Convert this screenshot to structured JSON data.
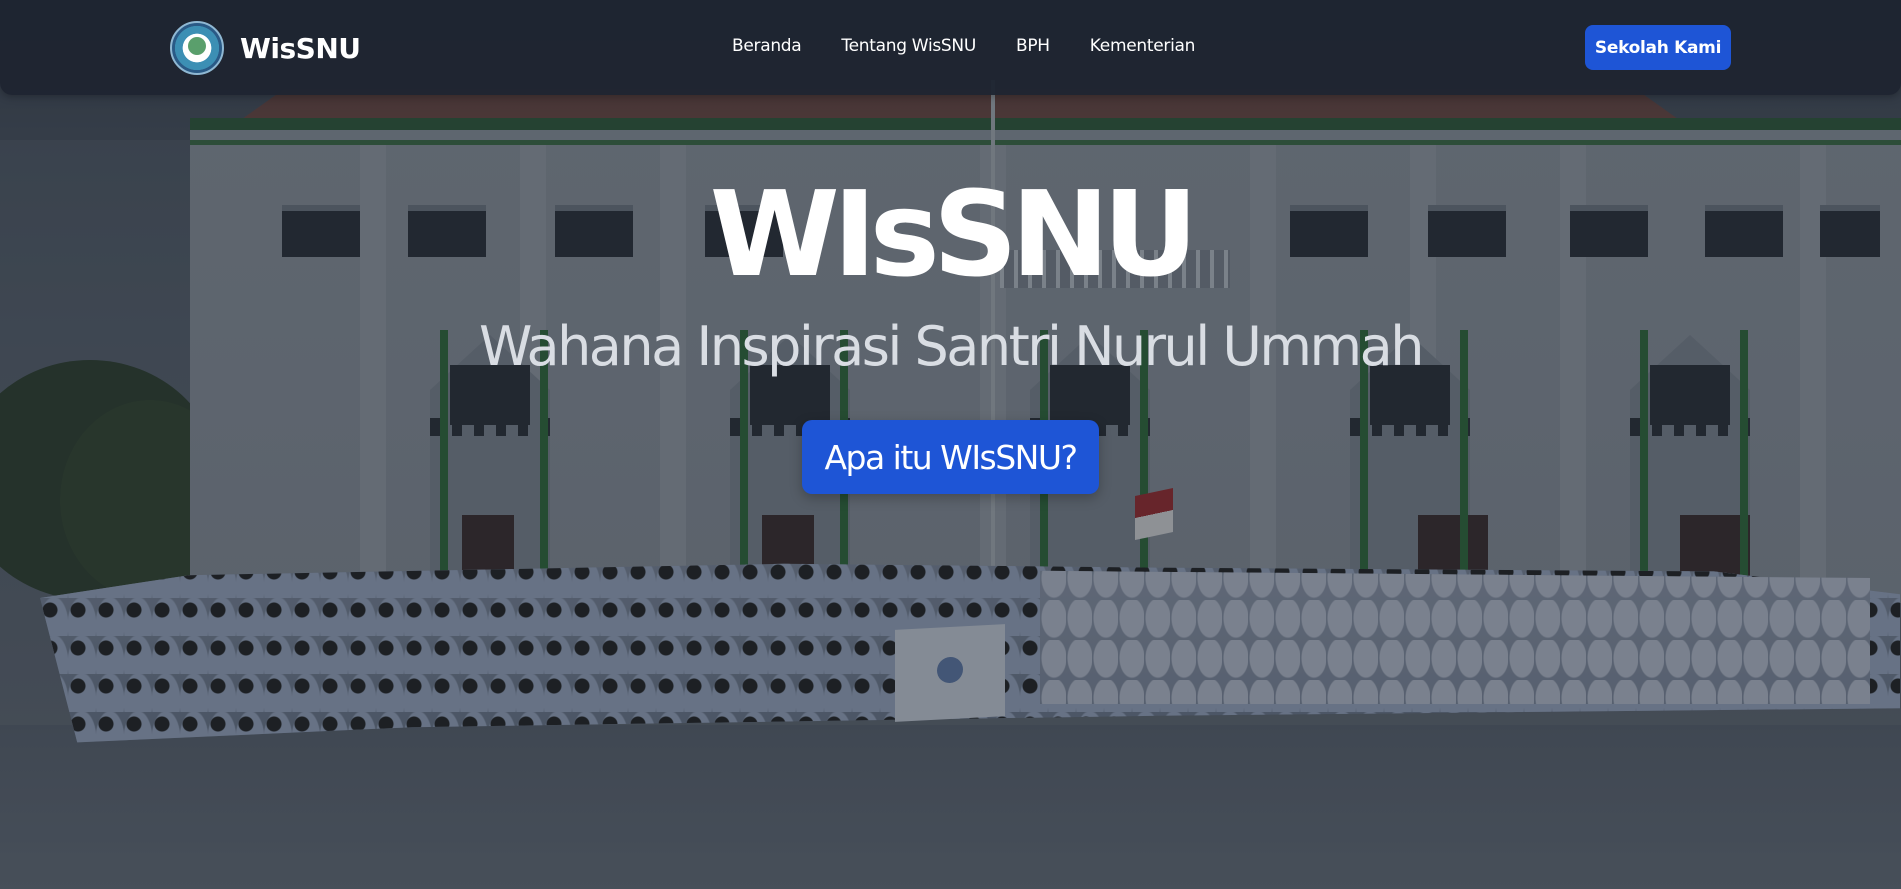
{
  "navbar": {
    "brand_name": "WisSNU",
    "logo_icon": "school-emblem-icon",
    "links": [
      {
        "label": "Beranda"
      },
      {
        "label": "Tentang WisSNU"
      },
      {
        "label": "BPH"
      },
      {
        "label": "Kementerian"
      }
    ],
    "cta_label": "Sekolah Kami"
  },
  "hero": {
    "title": "WIsSNU",
    "subtitle": "Wahana Inspirasi Santri Nurul Ummah",
    "button_label": "Apa itu WIsSNU?",
    "background": "school-group-photo"
  },
  "colors": {
    "accent": "#1e55d6",
    "navbar_bg": "#1e2431",
    "text": "#ffffff"
  }
}
